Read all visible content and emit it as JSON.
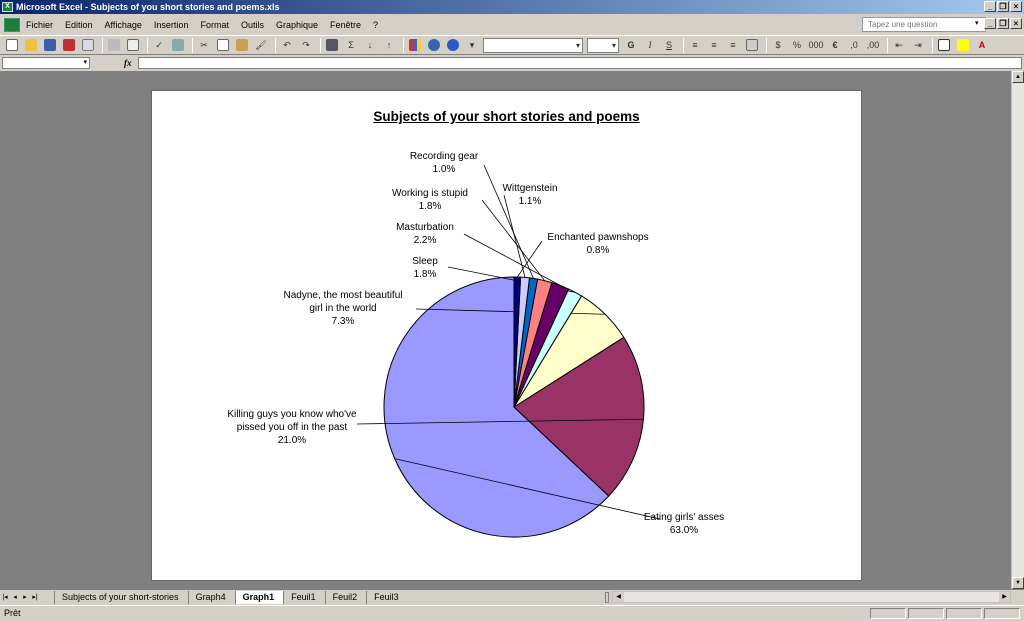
{
  "window": {
    "title": "Microsoft Excel - Subjects of you short stories and poems.xls"
  },
  "menu": {
    "items": [
      "Fichier",
      "Edition",
      "Affichage",
      "Insertion",
      "Format",
      "Outils",
      "Graphique",
      "Fenêtre",
      "?"
    ],
    "help_placeholder": "Tapez une question",
    "close_tooltip": "Close"
  },
  "formula": {
    "fx_label": "fx"
  },
  "chart": {
    "title": "Subjects of your short stories and poems"
  },
  "chart_data": {
    "type": "pie",
    "title": "Subjects of your short stories and poems",
    "slices": [
      {
        "label": "Eating girls' asses",
        "pct": "63.0%",
        "value": 63.0,
        "color": "#9999ff"
      },
      {
        "label": "Killing guys you know who've pissed you off in the past",
        "pct": "21.0%",
        "value": 21.0,
        "color": "#993366"
      },
      {
        "label": "Nadyne, the most beautiful girl in the world",
        "pct": "7.3%",
        "value": 7.3,
        "color": "#ffffcc"
      },
      {
        "label": "Sleep",
        "pct": "1.8%",
        "value": 1.8,
        "color": "#ccffff"
      },
      {
        "label": "Masturbation",
        "pct": "2.2%",
        "value": 2.2,
        "color": "#660066"
      },
      {
        "label": "Working is stupid",
        "pct": "1.8%",
        "value": 1.8,
        "color": "#ff8080"
      },
      {
        "label": "Recording gear",
        "pct": "1.0%",
        "value": 1.0,
        "color": "#0066cc"
      },
      {
        "label": "Wittgenstein",
        "pct": "1.1%",
        "value": 1.1,
        "color": "#ccccff"
      },
      {
        "label": "Enchanted  pawnshops",
        "pct": "0.8%",
        "value": 0.8,
        "color": "#000080"
      }
    ]
  },
  "labels": {
    "eating": {
      "line1": "Eating girls' asses",
      "pct": "63.0%"
    },
    "killing": {
      "line1": "Killing guys you know who've",
      "line2": "pissed you off in the past",
      "pct": "21.0%"
    },
    "nadyne": {
      "line1": "Nadyne, the most beautiful",
      "line2": "girl in the world",
      "pct": "7.3%"
    },
    "sleep": {
      "line1": "Sleep",
      "pct": "1.8%"
    },
    "masturbation": {
      "line1": "Masturbation",
      "pct": "2.2%"
    },
    "working": {
      "line1": "Working is stupid",
      "pct": "1.8%"
    },
    "recording": {
      "line1": "Recording gear",
      "pct": "1.0%"
    },
    "wittgenstein": {
      "line1": "Wittgenstein",
      "pct": "1.1%"
    },
    "pawnshops": {
      "line1": "Enchanted  pawnshops",
      "pct": "0.8%"
    }
  },
  "tabs": [
    "Subjects of your short-stories",
    "Graph4",
    "Graph1",
    "Feuil1",
    "Feuil2",
    "Feuil3"
  ],
  "active_tab": "Graph1",
  "status": {
    "text": "Prêt"
  }
}
